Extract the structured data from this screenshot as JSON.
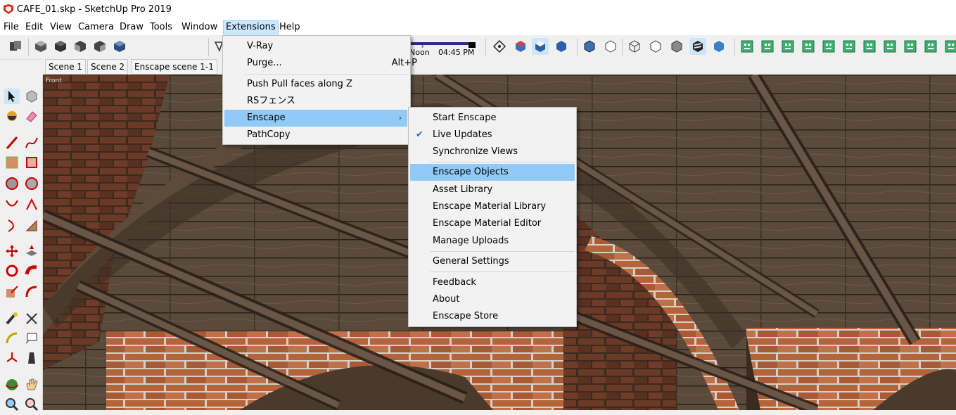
{
  "window": {
    "title": "CAFE_01.skp - SketchUp Pro 2019"
  },
  "menubar": {
    "items": [
      "File",
      "Edit",
      "View",
      "Camera",
      "Draw",
      "Tools",
      "Window",
      "Extensions",
      "Help"
    ],
    "active": "Extensions"
  },
  "toolbar": {
    "shadow_time_label": "Noon",
    "shadow_time_value": "04:45 PM"
  },
  "scenes": {
    "tabs": [
      "Scene 1",
      "Scene 2",
      "Enscape scene 1-1"
    ]
  },
  "viewport": {
    "view_label": "Front"
  },
  "extensions_menu": {
    "items": [
      {
        "label": "V-Ray",
        "submenu": true
      },
      {
        "label": "Purge...",
        "shortcut": "Alt+P"
      },
      {
        "label": "Push Pull faces along Z"
      },
      {
        "label": "RSフェンス",
        "submenu": true
      },
      {
        "label": "Enscape",
        "submenu": true,
        "highlighted": true
      },
      {
        "label": "PathCopy"
      }
    ]
  },
  "enscape_submenu": {
    "items": [
      {
        "label": "Start Enscape"
      },
      {
        "label": "Live Updates",
        "checked": true
      },
      {
        "label": "Synchronize Views"
      },
      {
        "label": "Enscape Objects",
        "highlighted": true
      },
      {
        "label": "Asset Library"
      },
      {
        "label": "Enscape Material Library"
      },
      {
        "label": "Enscape Material Editor"
      },
      {
        "label": "Manage Uploads"
      },
      {
        "label": "General Settings"
      },
      {
        "label": "Feedback"
      },
      {
        "label": "About"
      },
      {
        "label": "Enscape Store"
      }
    ]
  },
  "icons": {
    "left_toolbar": [
      "select-icon",
      "make-component-icon",
      "paint-bucket-icon",
      "eraser-icon",
      "line-icon",
      "freehand-icon",
      "rectangle-icon",
      "rotated-rectangle-icon",
      "circle-icon",
      "polygon-icon",
      "arc-icon",
      "pie-icon",
      "2-point-arc-icon",
      "3-point-arc-icon",
      "move-icon",
      "push-pull-icon",
      "rotate-icon",
      "follow-me-icon",
      "scale-icon",
      "offset-icon",
      "tape-measure-icon",
      "dimension-icon",
      "protractor-icon",
      "text-icon",
      "axes-icon",
      "3d-text-icon",
      "orbit-icon",
      "pan-icon",
      "zoom-icon",
      "zoom-window-icon"
    ]
  },
  "colors": {
    "menu_highlight": "#91c9f7",
    "menubar_active": "#cce8ff",
    "check": "#2a6ebb"
  }
}
